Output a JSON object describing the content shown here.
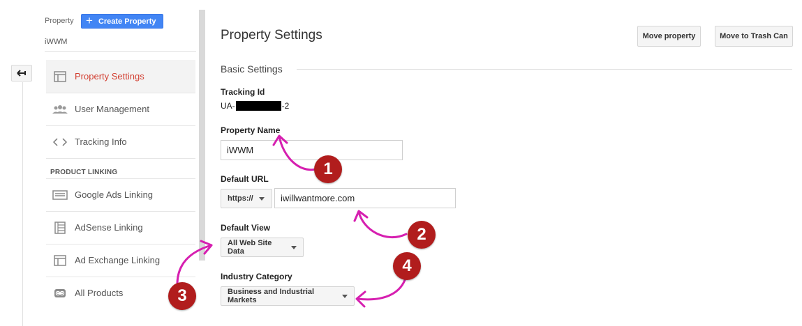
{
  "sidebar": {
    "property_label": "Property",
    "create_button": "Create Property",
    "account_name": "iWWM",
    "section_heading": "PRODUCT LINKING",
    "items": [
      {
        "label": "Property Settings",
        "icon": "property-settings-icon",
        "active": true
      },
      {
        "label": "User Management",
        "icon": "users-icon"
      },
      {
        "label": "Tracking Info",
        "icon": "code-icon"
      },
      {
        "label": "Google Ads Linking",
        "icon": "google-ads-icon"
      },
      {
        "label": "AdSense Linking",
        "icon": "adsense-icon"
      },
      {
        "label": "Ad Exchange Linking",
        "icon": "ad-exchange-icon"
      },
      {
        "label": "All Products",
        "icon": "link-icon"
      }
    ]
  },
  "main": {
    "title": "Property Settings",
    "move_button": "Move property",
    "trash_button": "Move to Trash Can",
    "section": "Basic Settings",
    "tracking": {
      "label": "Tracking Id",
      "prefix": "UA-",
      "suffix": "-2"
    },
    "property_name": {
      "label": "Property Name",
      "value": "iWWM"
    },
    "default_url": {
      "label": "Default URL",
      "protocol": "https://",
      "value": "iwillwantmore.com"
    },
    "default_view": {
      "label": "Default View",
      "value": "All Web Site Data"
    },
    "industry": {
      "label": "Industry Category",
      "value": "Business and Industrial Markets"
    }
  },
  "annotations": {
    "badge_1": "1",
    "badge_2": "2",
    "badge_3": "3",
    "badge_4": "4",
    "color": "#d61fb0",
    "badge_color": "#b11d1d"
  },
  "colors": {
    "accent": "#4285f4",
    "active_text": "#d23f31"
  }
}
